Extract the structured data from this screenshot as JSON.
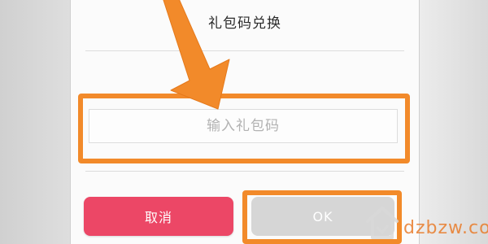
{
  "dialog": {
    "title": "礼包码兑换",
    "input": {
      "placeholder": "输入礼包码",
      "value": ""
    },
    "buttons": {
      "cancel_label": "取消",
      "ok_label": "OK"
    }
  },
  "annotation": {
    "highlight_color": "#f28a2a",
    "arrow_icon": "orange-arrow-icon"
  },
  "watermark": {
    "text": "dzbzw.com",
    "icon": "house-logo-icon"
  },
  "colors": {
    "cancel_button": "#ec4766",
    "ok_button_disabled": "#d6d6d6"
  }
}
